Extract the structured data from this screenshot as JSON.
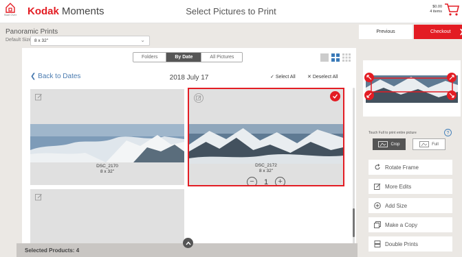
{
  "header": {
    "start_over_label": "Start Over",
    "brand_name": "Kodak",
    "brand_suffix": "Moments",
    "page_title": "Select Pictures to Print",
    "cart_amount": "$0.00",
    "cart_items": "4 items"
  },
  "product": {
    "name": "Panoramic Prints",
    "default_size_label": "Default Size:",
    "default_size_value": "8 x 32\""
  },
  "nav": {
    "previous_label": "Previous",
    "checkout_label": "Checkout"
  },
  "view": {
    "tabs": [
      {
        "label": "Folders",
        "active": false
      },
      {
        "label": "By Date",
        "active": true
      },
      {
        "label": "All Pictures",
        "active": false
      }
    ],
    "back_label": "Back to Dates",
    "date_title": "2018 July 17",
    "select_all_label": "Select All",
    "deselect_all_label": "Deselect All"
  },
  "photos": [
    {
      "name": "DSC_2170",
      "size": "8 x 32\"",
      "selected": false
    },
    {
      "name": "DSC_2172",
      "size": "8 x 32\"",
      "selected": true,
      "quantity": "1"
    },
    {
      "name": "",
      "size": "",
      "selected": false
    }
  ],
  "selection": {
    "label": "Selected Products: 4"
  },
  "editor": {
    "crop_hint": "Touch Full to print entire picture",
    "crop_label": "Crop",
    "full_label": "Full",
    "actions": [
      {
        "label": "Rotate Frame",
        "icon": "rotate-icon"
      },
      {
        "label": "More Edits",
        "icon": "edit-icon"
      },
      {
        "label": "Add Size",
        "icon": "add-icon"
      },
      {
        "label": "Make a Copy",
        "icon": "copy-icon"
      },
      {
        "label": "Double Prints",
        "icon": "double-prints-icon"
      }
    ]
  },
  "colors": {
    "brand_red": "#e31c23",
    "link_blue": "#4a7bb0",
    "active_tab": "#555555",
    "layout_icon_active": "#3a7ab8"
  }
}
